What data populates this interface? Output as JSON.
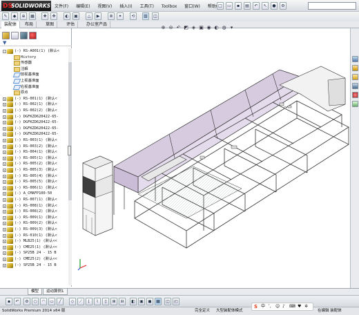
{
  "app": {
    "logo": "SOLIDWORKS",
    "logo_mark": "DS"
  },
  "menu": [
    "文件(F)",
    "编辑(E)",
    "视图(V)",
    "插入(I)",
    "工具(T)",
    "Toolbox",
    "窗口(W)",
    "帮助(H)"
  ],
  "command_tabs": [
    "装配体",
    "布局",
    "草图",
    "评估",
    "办公室产品"
  ],
  "feature_tree": [
    {
      "label": "(-) RS-A001(1) (默认<",
      "icon": "assembly-icon",
      "expand": "-",
      "level": 0
    },
    {
      "label": "History",
      "icon": "folder-icon",
      "level": 1
    },
    {
      "label": "传感器",
      "icon": "sensor-icon",
      "level": 1
    },
    {
      "label": "注解",
      "icon": "annotation-icon",
      "level": 1
    },
    {
      "label": "前视基准面",
      "icon": "plane-icon",
      "level": 1
    },
    {
      "label": "上视基准面",
      "icon": "plane-icon",
      "level": 1
    },
    {
      "label": "右视基准面",
      "icon": "plane-icon",
      "level": 1
    },
    {
      "label": "原点",
      "icon": "origin-icon",
      "level": 1
    },
    {
      "label": "(-) RS-001(1) (默认<",
      "icon": "part-icon",
      "expand": "+"
    },
    {
      "label": "(-) RS-002(1) (默认<",
      "icon": "part-icon",
      "expand": "+"
    },
    {
      "label": "(-) RS-002(2) (默认<",
      "icon": "part-icon",
      "expand": "+"
    },
    {
      "label": "(-) DGFKZD620422-65-",
      "icon": "part-icon",
      "expand": "+"
    },
    {
      "label": "(-) DGFKZD620422-65-",
      "icon": "part-icon",
      "expand": "+"
    },
    {
      "label": "(-) DGFKZD620422-65-",
      "icon": "part-icon",
      "expand": "+"
    },
    {
      "label": "(-) DGFKZD620422-65-",
      "icon": "part-icon",
      "expand": "+"
    },
    {
      "label": "(-) RS-003(1) (默认<",
      "icon": "part-icon",
      "expand": "+"
    },
    {
      "label": "(-) RS-003(2) (默认<",
      "icon": "part-icon",
      "expand": "+"
    },
    {
      "label": "(-) RS-004(1) (默认<",
      "icon": "part-icon",
      "expand": "+"
    },
    {
      "label": "(-) RS-005(1) (默认<",
      "icon": "part-icon",
      "expand": "+"
    },
    {
      "label": "(-) RS-005(2) (默认<",
      "icon": "part-icon",
      "expand": "+"
    },
    {
      "label": "(-) RS-005(3) (默认<",
      "icon": "part-icon",
      "expand": "+"
    },
    {
      "label": "(-) RS-005(4) (默认<",
      "icon": "part-icon",
      "expand": "+"
    },
    {
      "label": "(-) RS-005(5) (默认<",
      "icon": "part-icon",
      "expand": "+"
    },
    {
      "label": "(-) RS-006(1) (默认<",
      "icon": "part-icon",
      "expand": "+"
    },
    {
      "label": "(-) A_CMAFP100-50",
      "icon": "warning-part-icon",
      "expand": "+"
    },
    {
      "label": "(-) RS-007(1) (默认<",
      "icon": "part-icon",
      "expand": "+"
    },
    {
      "label": "(-) RS-008(1) (默认<",
      "icon": "part-icon",
      "expand": "+"
    },
    {
      "label": "(-) RS-008(2) (默认<",
      "icon": "part-icon",
      "expand": "+"
    },
    {
      "label": "(-) RS-009(1) (默认<",
      "icon": "part-icon",
      "expand": "+"
    },
    {
      "label": "(-) RS-009(2) (默认<",
      "icon": "part-icon",
      "expand": "+"
    },
    {
      "label": "(-) RS-009(3) (默认<",
      "icon": "part-icon",
      "expand": "+"
    },
    {
      "label": "(-) RS-010(1) (默认<",
      "icon": "part-icon",
      "expand": "+"
    },
    {
      "label": "(-) MLB25(1) (默认<<",
      "icon": "part-icon",
      "expand": "+"
    },
    {
      "label": "(-) CME25(1) (默认<<",
      "icon": "part-icon",
      "expand": "+"
    },
    {
      "label": "(-) SP25B 24 - 15 B",
      "icon": "part-icon",
      "expand": "+"
    },
    {
      "label": "(-) CME25(2) (默认<<",
      "icon": "part-icon",
      "expand": "+"
    },
    {
      "label": "(-) SP25B 24 - 15 B",
      "icon": "part-icon",
      "expand": "+"
    }
  ],
  "bottom_tabs": [
    "模型",
    "运动算例1"
  ],
  "status": {
    "left": "SolidWorks Premium 2014 x64 版",
    "state": "完全定义",
    "edit": "大型装配体模式",
    "mode": "在编辑 装配体",
    "ime": "中"
  },
  "colors": {
    "panel_tint": "#d7cbe0",
    "logo_red": "#e22222",
    "accent": "#2b63b9"
  }
}
